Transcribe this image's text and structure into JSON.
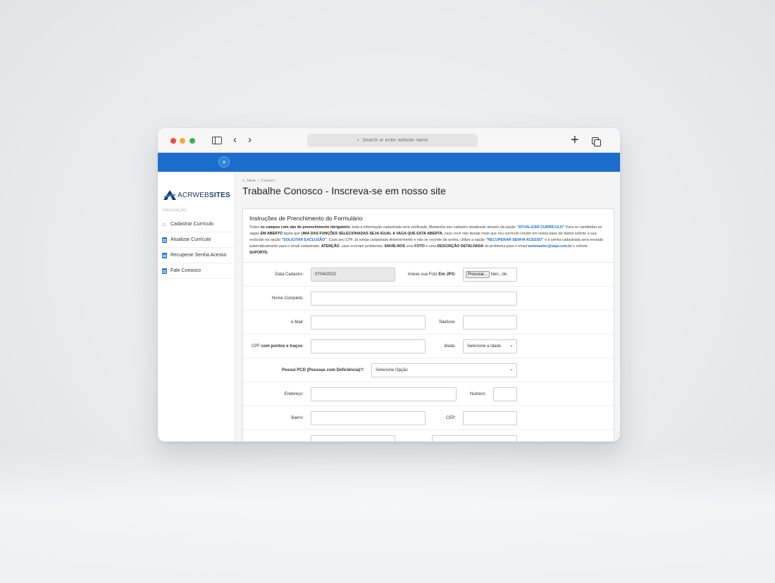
{
  "browser": {
    "address_placeholder": "Search or enter website name"
  },
  "logo": {
    "part1": "ACRWEB",
    "part2": "SITES"
  },
  "sidebar": {
    "section_label": "NAVEGAÇÃO",
    "items": [
      {
        "label": "Cadastrar Currículo",
        "icon": "home-icon"
      },
      {
        "label": "Atualizar Currículo",
        "icon": "document-icon"
      },
      {
        "label": "Recuperar Senha Acesso",
        "icon": "document-icon"
      },
      {
        "label": "Fale Conosco",
        "icon": "document-icon"
      }
    ]
  },
  "breadcrumb": {
    "home": "Início",
    "current": "Cadastro"
  },
  "page_title": "Trabalhe Conosco - Inscreva-se em nosso site",
  "instructions": {
    "title": "Instruções de Prenchimento do Formulário",
    "p1": "Todos ",
    "p1b": "os campos com são de preenchimento obrigatório",
    "p2": ", toda a informação cadastrada será verificada, Mantenha seu cadastro atualizado através da opção ",
    "p2blue": "\"ATUALIZAR CURRÍCULO\"",
    "p3": " Para se candidatar as vagas ",
    "p3b": "EM ABERTO",
    "p4": " basta que ",
    "p4b": "UMA DAS FUNÇÕES SELECIONADAS SEJA IGUAL A VAGA QUE ESTA ABERTA",
    "p5": ", caso você não deseje mais que seu currículo conste em nossa base de dados solicite a sua exclusão na opção ",
    "p5blue": "\"SOLICITAR EXCLUSÃO\"",
    "p6": ". Caso seu CPF Já esteja cadastrado Anteriormente e não se recorde da senha, Utilize a opção ",
    "p6blue": "\"RECUPERAR SENHA ACESSO\"",
    "p7": " e a senha cadastrada será enviada automáticamente para o email cadastrado. ",
    "p7b": "ATENÇÃO",
    "p8": ", caso ocorram problemas, ",
    "p8b": "ENVIE-NOS",
    "p9": " uma ",
    "p9b": "FOTO",
    "p10": " e uma ",
    "p10b": "DESCRIÇÃO DETALHADA",
    "p11": " do problema para o email ",
    "p11blue": "webmaster@seja.com.br",
    "p12": " e solicite ",
    "p12b": "SUPORTE",
    "p13": "."
  },
  "form": {
    "data_cadastro_label": "Data Cadastro:",
    "data_cadastro_value": "07/04/2022",
    "foto_label_a": "Anexe sua Foto ",
    "foto_label_b": "Em JPG",
    "foto_label_c": ":",
    "file_button": "Procurar...",
    "file_status": "Nen...do.",
    "nome_label": "Nome Completo:",
    "email_label": "e-Mail:",
    "telefone_label": "Telefone:",
    "cpf_label_a": "CPF ",
    "cpf_label_b": "com pontos e traços",
    "cpf_label_c": ":",
    "idade_label": "Idade:",
    "idade_value": "Selecione a Idade",
    "pcd_label": "Possui PCD (Pessoas com Deficiência)?:",
    "pcd_value": "Selecione Opção",
    "endereco_label": "Endereço:",
    "numero_label": "Numero:",
    "bairro_label": "Bairro:",
    "cep_label": "CEP:"
  }
}
